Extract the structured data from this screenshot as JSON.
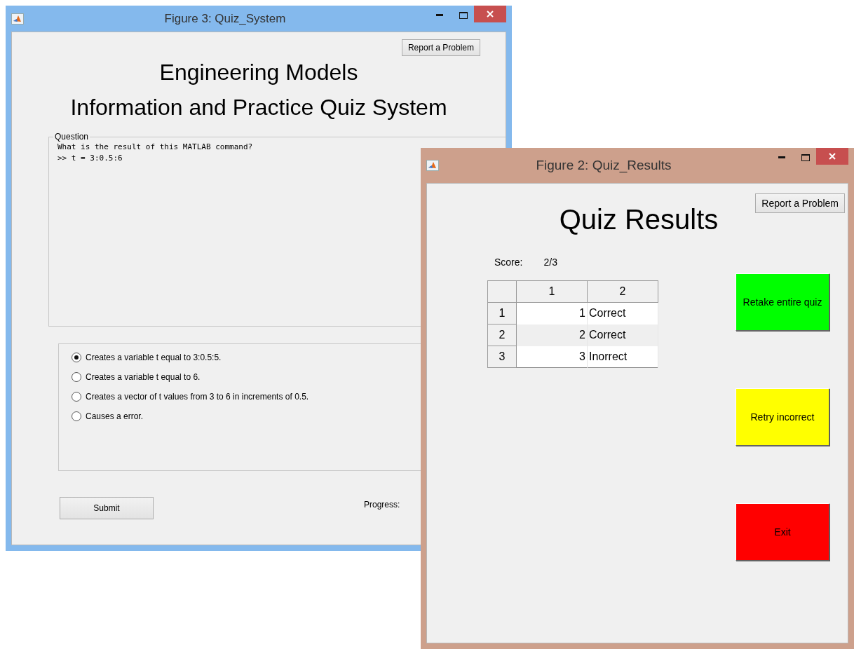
{
  "quiz_window": {
    "title": "Figure 3: Quiz_System",
    "report_button": "Report a Problem",
    "heading_lines": [
      "Engineering Models",
      "Information and Practice Quiz System"
    ],
    "question": {
      "legend": "Question",
      "lines": [
        "What is the result of this MATLAB command?",
        ">> t = 3:0.5:6"
      ]
    },
    "answers": [
      {
        "label": "Creates a variable t equal to 3:0.5:5.",
        "selected": true
      },
      {
        "label": "Creates a variable t equal to 6.",
        "selected": false
      },
      {
        "label": "Creates a vector of t values from 3 to 6 in increments of 0.5.",
        "selected": false
      },
      {
        "label": "Causes a error.",
        "selected": false
      }
    ],
    "submit_button": "Submit",
    "progress_label": "Progress:"
  },
  "results_window": {
    "title": "Figure 2: Quiz_Results",
    "report_button": "Report a Problem",
    "heading": "Quiz Results",
    "score_label": "Score:",
    "score_value": "2/3",
    "table": {
      "columns": [
        "1",
        "2"
      ],
      "rows": [
        {
          "header": "1",
          "cells": [
            "1",
            "Correct"
          ]
        },
        {
          "header": "2",
          "cells": [
            "2",
            "Correct"
          ]
        },
        {
          "header": "3",
          "cells": [
            "3",
            "Inorrect"
          ]
        }
      ]
    },
    "actions": [
      {
        "label": "Retake entire quiz",
        "color": "#00ff00"
      },
      {
        "label": "Retry incorrect",
        "color": "#ffff00"
      },
      {
        "label": "Exit",
        "color": "#ff0000"
      }
    ]
  }
}
